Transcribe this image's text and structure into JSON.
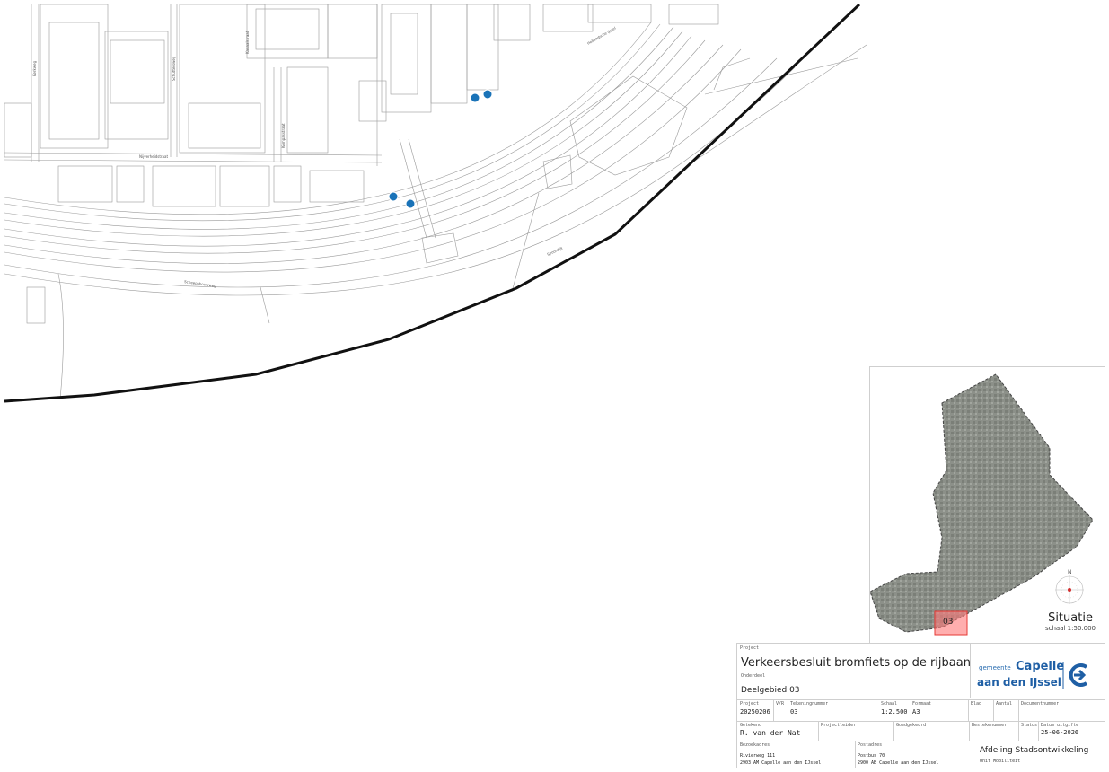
{
  "map": {
    "street_labels": [
      "Kerkweg",
      "Schuttersweg",
      "Rivium",
      "Hollandsche IJssel",
      "Nijverheidstraat",
      "Kanaalstraat",
      "Kompasstraat",
      "Scheepsbouwweg",
      "Spoordijk"
    ],
    "signs": [
      "bromfiets-rijbaan-sign",
      "bromfiets-rijbaan-sign",
      "bromfiets-rijbaan-sign",
      "bromfiets-rijbaan-sign"
    ]
  },
  "inset": {
    "title": "Situatie",
    "scale": "schaal 1:50.000",
    "marker_label": "03",
    "north_label": "N"
  },
  "titleblock": {
    "project_label": "Project",
    "project_title": "Verkeersbesluit bromfiets op de rijbaan",
    "onderdeel_label": "Onderdeel",
    "onderdeel": "Deelgebied 03",
    "logo": {
      "gemeente": "gemeente",
      "capelle": "Capelle",
      "aan_den": "aan den IJssel"
    },
    "row1": [
      {
        "label": "Project",
        "value": "20250206"
      },
      {
        "label": "V/R",
        "value": ""
      },
      {
        "label": "Tekeningnummer",
        "value": "03"
      },
      {
        "label": "Schaal",
        "value": "1:2.500"
      },
      {
        "label": "Formaat",
        "value": "A3"
      },
      {
        "label": "Blad",
        "value": ""
      },
      {
        "label": "Aantal",
        "value": ""
      },
      {
        "label": "Documentnummer",
        "value": ""
      }
    ],
    "row2": [
      {
        "label": "Getekend",
        "value": "R. van der Nat"
      },
      {
        "label": "Projectleider",
        "value": ""
      },
      {
        "label": "Goedgekeurd",
        "value": ""
      },
      {
        "label": "Bestekenummer",
        "value": ""
      },
      {
        "label": "Status",
        "value": ""
      },
      {
        "label": "Datum uitgifte",
        "value": "25-06-2026"
      }
    ],
    "bezoekadres_label": "Bezoekadres",
    "bezoekadres_1": "Rivierweg 111",
    "bezoekadres_2": "2903 AM Capelle aan den IJssel",
    "postadres_label": "Postadres",
    "postadres_1": "Postbus 70",
    "postadres_2": "2900 AB Capelle aan den IJssel",
    "afdeling": "Afdeling Stadsontwikkeling",
    "unit": "Unit Mobiliteit"
  }
}
